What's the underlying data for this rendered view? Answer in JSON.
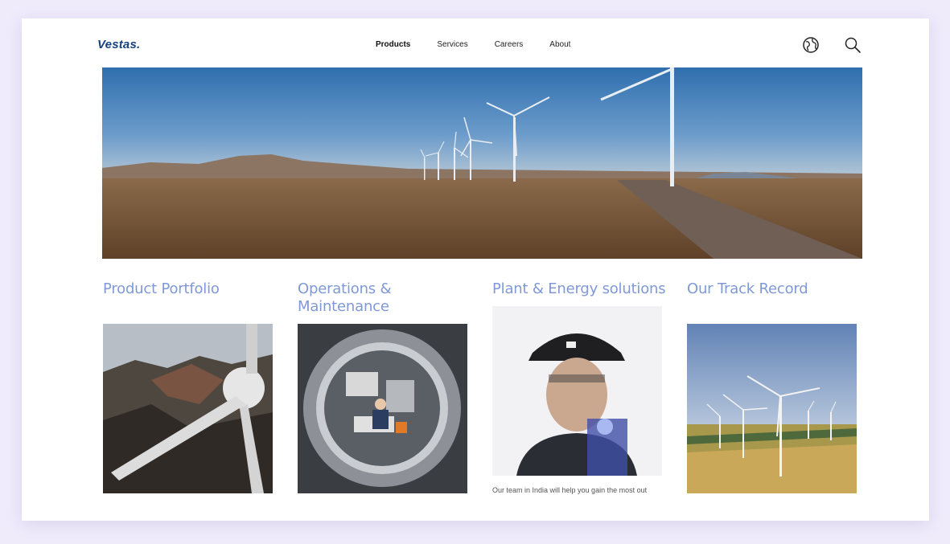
{
  "header": {
    "logo_text": "Vestas.",
    "nav": [
      {
        "label": "Products",
        "active": true
      },
      {
        "label": "Services",
        "active": false
      },
      {
        "label": "Careers",
        "active": false
      },
      {
        "label": "About",
        "active": false
      }
    ],
    "icons": [
      "globe-icon",
      "search-icon"
    ]
  },
  "cards": [
    {
      "title": "Product  Portfolio"
    },
    {
      "title": "Operations & Maintenance"
    },
    {
      "title": "Plant & Energy solutions",
      "caption": "Our team in India will help you gain the most out"
    },
    {
      "title": "Our Track Record"
    }
  ],
  "colors": {
    "brand": "#16437e",
    "accent_title": "#7f98d6",
    "background": "#efebfb"
  }
}
